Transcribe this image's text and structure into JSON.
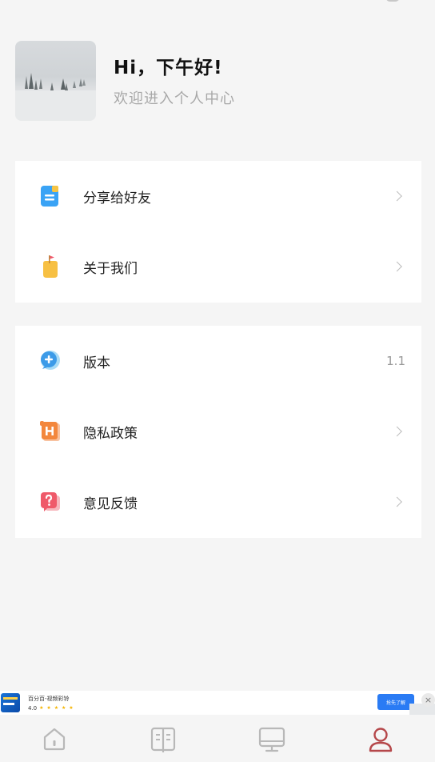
{
  "profile": {
    "greeting": "Hi，下午好!",
    "subtitle": "欢迎进入个人中心"
  },
  "menu_group_1": [
    {
      "label": "分享给好友",
      "icon": "share-document-icon"
    },
    {
      "label": "关于我们",
      "icon": "about-bag-flag-icon"
    }
  ],
  "menu_group_2": [
    {
      "label": "版本",
      "icon": "version-chat-plus-icon",
      "value": "1.1"
    },
    {
      "label": "隐私政策",
      "icon": "privacy-scroll-icon"
    },
    {
      "label": "意见反馈",
      "icon": "feedback-question-icon"
    }
  ],
  "ad": {
    "title": "百分百-视频彩铃",
    "rating": "4.0",
    "stars": "★ ★ ★ ★ ★",
    "button": "抢先了解",
    "close": "×"
  },
  "tabbar": [
    {
      "name": "home",
      "icon": "home-icon",
      "active": false
    },
    {
      "name": "book",
      "icon": "book-icon",
      "active": false
    },
    {
      "name": "screen",
      "icon": "monitor-icon",
      "active": false
    },
    {
      "name": "profile",
      "icon": "user-icon",
      "active": true
    }
  ],
  "colors": {
    "background": "#f5f5f5",
    "card": "#ffffff",
    "active_tab": "#b5474a",
    "inactive_tab": "#b8b8b8",
    "ad_button": "#2a7bf4"
  }
}
